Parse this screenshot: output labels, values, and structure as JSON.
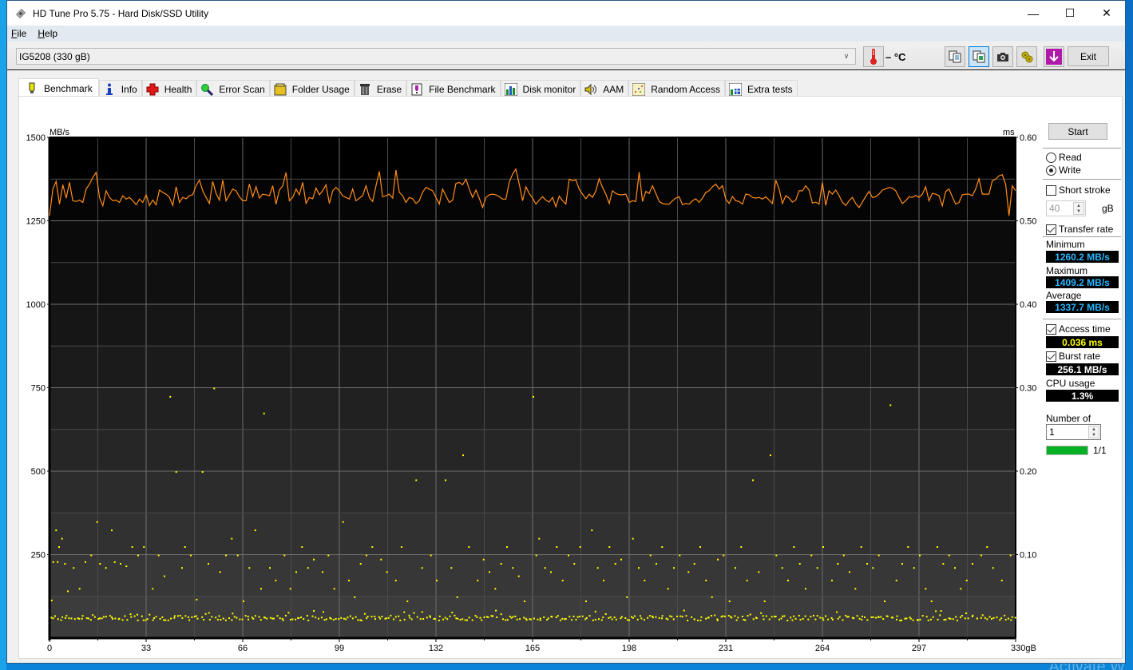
{
  "window": {
    "title": "HD Tune Pro 5.75 - Hard Disk/SSD Utility",
    "controls": {
      "minimize": "—",
      "maximize": "☐",
      "close": "✕"
    }
  },
  "menu": [
    {
      "label": "File",
      "accel": "F"
    },
    {
      "label": "Help",
      "accel": "H"
    }
  ],
  "toolbar": {
    "drive": "IG5208 (330 gB)",
    "temperature": "– °C",
    "buttons": [
      "copy-text-icon",
      "copy-screenshot-icon",
      "camera-icon",
      "options-icon",
      "save-icon"
    ],
    "exit_label": "Exit"
  },
  "tabs": [
    {
      "label": "Benchmark",
      "icon": "lightbulb-icon",
      "active": true
    },
    {
      "label": "Info",
      "icon": "info-icon"
    },
    {
      "label": "Health",
      "icon": "health-cross-icon"
    },
    {
      "label": "Error Scan",
      "icon": "magnifier-icon"
    },
    {
      "label": "Folder Usage",
      "icon": "folder-icon"
    },
    {
      "label": "Erase",
      "icon": "trash-icon"
    },
    {
      "label": "File Benchmark",
      "icon": "file-benchmark-icon"
    },
    {
      "label": "Disk monitor",
      "icon": "bar-chart-icon"
    },
    {
      "label": "AAM",
      "icon": "speaker-icon"
    },
    {
      "label": "Random Access",
      "icon": "scatter-icon"
    },
    {
      "label": "Extra tests",
      "icon": "extra-tests-icon"
    }
  ],
  "side": {
    "start_label": "Start",
    "read_label": "Read",
    "write_label": "Write",
    "mode": "write",
    "short_stroke_label": "Short stroke",
    "short_stroke_checked": false,
    "short_stroke_value": "40",
    "short_stroke_unit": "gB",
    "transfer_rate_label": "Transfer rate",
    "transfer_rate_checked": true,
    "minimum_label": "Minimum",
    "minimum_value": "1260.2 MB/s",
    "maximum_label": "Maximum",
    "maximum_value": "1409.2 MB/s",
    "average_label": "Average",
    "average_value": "1337.7 MB/s",
    "access_time_label": "Access time",
    "access_time_checked": true,
    "access_time_value": "0.036 ms",
    "burst_rate_label": "Burst rate",
    "burst_rate_checked": true,
    "burst_rate_value": "256.1 MB/s",
    "cpu_label": "CPU usage",
    "cpu_value": "1.3%",
    "passes_label": "Number of passes",
    "passes_value": "1",
    "progress_fraction": 1.0,
    "progress_text": "1/1"
  },
  "chart_data": {
    "type": "line",
    "title": "",
    "xlabel": "gB",
    "ylabel_left": "MB/s",
    "ylabel_right": "ms",
    "xlim": [
      0,
      330
    ],
    "ylim_left": [
      0,
      1500
    ],
    "ylim_right": [
      0,
      0.6
    ],
    "x_ticks": [
      "0",
      "33",
      "66",
      "99",
      "132",
      "165",
      "198",
      "231",
      "264",
      "297",
      "330gB"
    ],
    "y_ticks_left": [
      "1500",
      "1250",
      "1000",
      "750",
      "500",
      "250"
    ],
    "y_ticks_right": [
      "0.60",
      "0.50",
      "0.40",
      "0.30",
      "0.20",
      "0.10"
    ],
    "grid": true,
    "colors": {
      "transfer": "#ff8c1a",
      "access": "#ffff00"
    },
    "series": [
      {
        "name": "Transfer rate (MB/s)",
        "axis": "left",
        "values": [
          1265,
          1345,
          1368,
          1300,
          1358,
          1318,
          1365,
          1310,
          1308,
          1312,
          1305,
          1345,
          1360,
          1380,
          1395,
          1320,
          1295,
          1340,
          1320,
          1310,
          1312,
          1305,
          1325,
          1315,
          1320,
          1310,
          1298,
          1315,
          1305,
          1328,
          1296,
          1312,
          1298,
          1342,
          1335,
          1330,
          1320,
          1296,
          1352,
          1305,
          1320,
          1316,
          1325,
          1328,
          1355,
          1372,
          1340,
          1320,
          1302,
          1368,
          1332,
          1312,
          1372,
          1310,
          1328,
          1345,
          1340,
          1322,
          1310,
          1310,
          1360,
          1322,
          1352,
          1318,
          1330,
          1328,
          1325,
          1355,
          1300,
          1342,
          1355,
          1395,
          1310,
          1320,
          1345,
          1328,
          1365,
          1302,
          1320,
          1316,
          1348,
          1328,
          1340,
          1358,
          1302,
          1340,
          1350,
          1340,
          1325,
          1320,
          1315,
          1345,
          1310,
          1318,
          1325,
          1355,
          1320,
          1308,
          1355,
          1398,
          1322,
          1325,
          1330,
          1318,
          1402,
          1335,
          1325,
          1305,
          1320,
          1316,
          1302,
          1310,
          1336,
          1350,
          1345,
          1340,
          1320,
          1300,
          1345,
          1325,
          1305,
          1312,
          1362,
          1365,
          1358,
          1375,
          1345,
          1320,
          1342,
          1318,
          1290,
          1320,
          1328,
          1330,
          1328,
          1322,
          1315,
          1315,
          1366,
          1390,
          1405,
          1360,
          1310,
          1352,
          1332,
          1318,
          1300,
          1312,
          1322,
          1312,
          1306,
          1320,
          1292,
          1324,
          1310,
          1300,
          1375,
          1370,
          1373,
          1345,
          1330,
          1316,
          1330,
          1320,
          1340,
          1376,
          1350,
          1330,
          1302,
          1340,
          1332,
          1328,
          1328,
          1330,
          1305,
          1310,
          1308,
          1396,
          1308,
          1338,
          1332,
          1355,
          1332,
          1308,
          1302,
          1300,
          1300,
          1310,
          1318,
          1322,
          1298,
          1302,
          1300,
          1310,
          1316,
          1305,
          1318,
          1335,
          1340,
          1352,
          1360,
          1345,
          1355,
          1315,
          1302,
          1323,
          1310,
          1308,
          1300,
          1330,
          1328,
          1320,
          1318,
          1320,
          1315,
          1322,
          1312,
          1302,
          1372,
          1345,
          1302,
          1325,
          1318,
          1306,
          1312,
          1340,
          1340,
          1355,
          1342,
          1303,
          1306,
          1300,
          1365,
          1296,
          1340,
          1330,
          1342,
          1325,
          1306,
          1296,
          1310,
          1320,
          1302,
          1290,
          1306,
          1323,
          1338,
          1320,
          1322,
          1330,
          1342,
          1346,
          1350,
          1348,
          1340,
          1320,
          1302,
          1310,
          1322,
          1320,
          1326,
          1320,
          1330,
          1352,
          1310,
          1332,
          1330,
          1325,
          1295,
          1338,
          1345,
          1322,
          1300,
          1305,
          1328,
          1330,
          1330,
          1325,
          1345,
          1376,
          1330,
          1330,
          1330,
          1370,
          1375,
          1385,
          1388,
          1360,
          1265,
          1355,
          1340
        ],
        "min": 1260.2,
        "max": 1409.2,
        "average": 1337.7
      },
      {
        "name": "Access time (ms)",
        "axis": "right",
        "type": "scatter",
        "baseline_ms": 0.025,
        "outliers_ms": [
          [
            0.5,
            0.046
          ],
          [
            1,
            0.092
          ],
          [
            2,
            0.13
          ],
          [
            2.5,
            0.092
          ],
          [
            3,
            0.11
          ],
          [
            4,
            0.12
          ],
          [
            5,
            0.09
          ],
          [
            6,
            0.057
          ],
          [
            8,
            0.085
          ],
          [
            10,
            0.06
          ],
          [
            12,
            0.092
          ],
          [
            14,
            0.1
          ],
          [
            16,
            0.14
          ],
          [
            17,
            0.09
          ],
          [
            19,
            0.085
          ],
          [
            21,
            0.13
          ],
          [
            22,
            0.092
          ],
          [
            24,
            0.09
          ],
          [
            26,
            0.087
          ],
          [
            28,
            0.11
          ],
          [
            30,
            0.1
          ],
          [
            32,
            0.11
          ],
          [
            35,
            0.06
          ],
          [
            37,
            0.1
          ],
          [
            39,
            0.075
          ],
          [
            41,
            0.29
          ],
          [
            43,
            0.2
          ],
          [
            45,
            0.085
          ],
          [
            46,
            0.11
          ],
          [
            48,
            0.1
          ],
          [
            50,
            0.047
          ],
          [
            52,
            0.2
          ],
          [
            54,
            0.09
          ],
          [
            56,
            0.3
          ],
          [
            58,
            0.08
          ],
          [
            60,
            0.1
          ],
          [
            62,
            0.12
          ],
          [
            64,
            0.1
          ],
          [
            66,
            0.045
          ],
          [
            68,
            0.085
          ],
          [
            70,
            0.13
          ],
          [
            72,
            0.06
          ],
          [
            73,
            0.27
          ],
          [
            75,
            0.085
          ],
          [
            77,
            0.07
          ],
          [
            80,
            0.1
          ],
          [
            82,
            0.06
          ],
          [
            84,
            0.08
          ],
          [
            86,
            0.11
          ],
          [
            88,
            0.085
          ],
          [
            90,
            0.095
          ],
          [
            93,
            0.08
          ],
          [
            95,
            0.1
          ],
          [
            97,
            0.06
          ],
          [
            100,
            0.14
          ],
          [
            102,
            0.07
          ],
          [
            104,
            0.05
          ],
          [
            106,
            0.09
          ],
          [
            108,
            0.1
          ],
          [
            110,
            0.11
          ],
          [
            113,
            0.095
          ],
          [
            115,
            0.08
          ],
          [
            118,
            0.07
          ],
          [
            120,
            0.11
          ],
          [
            122,
            0.045
          ],
          [
            125,
            0.19
          ],
          [
            127,
            0.085
          ],
          [
            130,
            0.1
          ],
          [
            132,
            0.07
          ],
          [
            135,
            0.19
          ],
          [
            137,
            0.085
          ],
          [
            139,
            0.05
          ],
          [
            141,
            0.22
          ],
          [
            143,
            0.11
          ],
          [
            146,
            0.07
          ],
          [
            148,
            0.095
          ],
          [
            150,
            0.08
          ],
          [
            152,
            0.06
          ],
          [
            154,
            0.09
          ],
          [
            156,
            0.11
          ],
          [
            158,
            0.085
          ],
          [
            160,
            0.075
          ],
          [
            162,
            0.045
          ],
          [
            165,
            0.29
          ],
          [
            166,
            0.1
          ],
          [
            167,
            0.12
          ],
          [
            169,
            0.085
          ],
          [
            171,
            0.08
          ],
          [
            173,
            0.11
          ],
          [
            175,
            0.07
          ],
          [
            177,
            0.1
          ],
          [
            179,
            0.09
          ],
          [
            181,
            0.11
          ],
          [
            183,
            0.045
          ],
          [
            185,
            0.13
          ],
          [
            187,
            0.085
          ],
          [
            189,
            0.07
          ],
          [
            191,
            0.11
          ],
          [
            193,
            0.09
          ],
          [
            195,
            0.095
          ],
          [
            197,
            0.05
          ],
          [
            199,
            0.12
          ],
          [
            201,
            0.085
          ],
          [
            203,
            0.07
          ],
          [
            205,
            0.1
          ],
          [
            207,
            0.09
          ],
          [
            209,
            0.11
          ],
          [
            211,
            0.06
          ],
          [
            213,
            0.085
          ],
          [
            215,
            0.1
          ],
          [
            218,
            0.08
          ],
          [
            220,
            0.09
          ],
          [
            222,
            0.11
          ],
          [
            224,
            0.07
          ],
          [
            226,
            0.05
          ],
          [
            228,
            0.095
          ],
          [
            230,
            0.1
          ],
          [
            232,
            0.045
          ],
          [
            234,
            0.085
          ],
          [
            236,
            0.11
          ],
          [
            238,
            0.07
          ],
          [
            240,
            0.19
          ],
          [
            242,
            0.08
          ],
          [
            244,
            0.045
          ],
          [
            246,
            0.22
          ],
          [
            248,
            0.1
          ],
          [
            250,
            0.085
          ],
          [
            252,
            0.07
          ],
          [
            254,
            0.11
          ],
          [
            256,
            0.09
          ],
          [
            258,
            0.06
          ],
          [
            260,
            0.1
          ],
          [
            262,
            0.085
          ],
          [
            264,
            0.11
          ],
          [
            267,
            0.07
          ],
          [
            269,
            0.09
          ],
          [
            271,
            0.1
          ],
          [
            273,
            0.08
          ],
          [
            275,
            0.06
          ],
          [
            277,
            0.11
          ],
          [
            279,
            0.09
          ],
          [
            281,
            0.085
          ],
          [
            283,
            0.1
          ],
          [
            285,
            0.045
          ],
          [
            287,
            0.28
          ],
          [
            289,
            0.07
          ],
          [
            291,
            0.09
          ],
          [
            293,
            0.11
          ],
          [
            295,
            0.085
          ],
          [
            297,
            0.1
          ],
          [
            299,
            0.06
          ],
          [
            301,
            0.045
          ],
          [
            303,
            0.11
          ],
          [
            305,
            0.09
          ],
          [
            307,
            0.1
          ],
          [
            309,
            0.085
          ],
          [
            311,
            0.06
          ],
          [
            313,
            0.07
          ],
          [
            315,
            0.09
          ],
          [
            318,
            0.1
          ],
          [
            320,
            0.11
          ],
          [
            322,
            0.085
          ],
          [
            325,
            0.07
          ],
          [
            328,
            0.1
          ]
        ]
      }
    ]
  }
}
